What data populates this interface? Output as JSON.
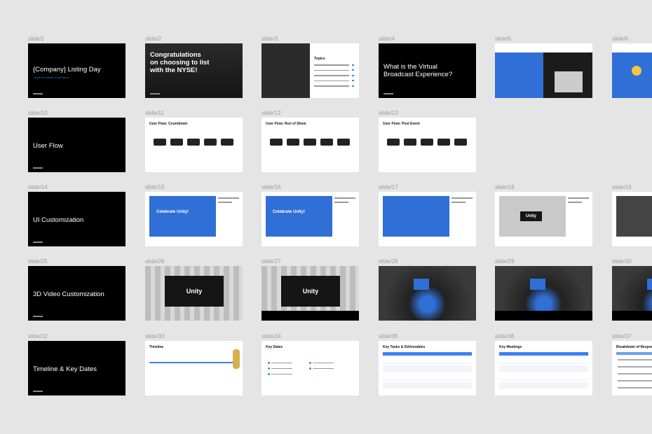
{
  "canvas": {
    "background": "#e5e5e5",
    "accent": "#2f6fd6"
  },
  "rows": [
    [
      {
        "label": "slide/1",
        "kind": "dark",
        "title": "{Company} Listing Day",
        "subtitle": "Virtual Broadcast Experience"
      },
      {
        "label": "slide/2",
        "kind": "photo",
        "title": "Congratulations on choosing to list with the NYSE!"
      },
      {
        "label": "slide/3",
        "kind": "topics",
        "title": "Topics"
      },
      {
        "label": "slide/4",
        "kind": "dark",
        "title": "What is the Virtual Broadcast Experience?"
      },
      {
        "label": "slide/5",
        "kind": "mixed",
        "title": ""
      },
      {
        "label": "slide/6",
        "kind": "emoji",
        "title": ""
      }
    ],
    [
      {
        "label": "slide/10",
        "kind": "dark",
        "title": "User Flow"
      },
      {
        "label": "slide/11",
        "kind": "flow",
        "title": "User Flow: Countdown"
      },
      {
        "label": "slide/12",
        "kind": "flow",
        "title": "User Flow: Run of Show"
      },
      {
        "label": "slide/13",
        "kind": "flow",
        "title": "User Flow: Post Event"
      }
    ],
    [
      {
        "label": "slide/14",
        "kind": "dark",
        "title": "UI Customization"
      },
      {
        "label": "slide/15",
        "kind": "ui",
        "title": "Celebrate Unity!"
      },
      {
        "label": "slide/16",
        "kind": "ui",
        "title": "Celebrate Unity!"
      },
      {
        "label": "slide/17",
        "kind": "ui",
        "title": ""
      },
      {
        "label": "slide/18",
        "kind": "uifacade",
        "title": "Unity"
      },
      {
        "label": "slide/19",
        "kind": "uiphoto",
        "title": ""
      }
    ],
    [
      {
        "label": "slide/25",
        "kind": "dark",
        "title": "3D Video Customization"
      },
      {
        "label": "slide/26",
        "kind": "facade",
        "title": "Unity"
      },
      {
        "label": "slide/27",
        "kind": "facadebar",
        "title": "Unity"
      },
      {
        "label": "slide/28",
        "kind": "floor",
        "title": ""
      },
      {
        "label": "slide/29",
        "kind": "floorbar",
        "title": ""
      },
      {
        "label": "slide/30",
        "kind": "floorbar",
        "title": ""
      }
    ],
    [
      {
        "label": "slide/32",
        "kind": "dark",
        "title": "Timeline & Key Dates"
      },
      {
        "label": "slide/33",
        "kind": "timeline",
        "title": "Timeline"
      },
      {
        "label": "slide/34",
        "kind": "keydates",
        "title": "Key Dates"
      },
      {
        "label": "slide/35",
        "kind": "table",
        "title": "Key Tasks & Deliverables"
      },
      {
        "label": "slide/36",
        "kind": "table",
        "title": "Key Meetings"
      },
      {
        "label": "slide/37",
        "kind": "list",
        "title": "Breakdown of Responsibilities"
      }
    ]
  ]
}
